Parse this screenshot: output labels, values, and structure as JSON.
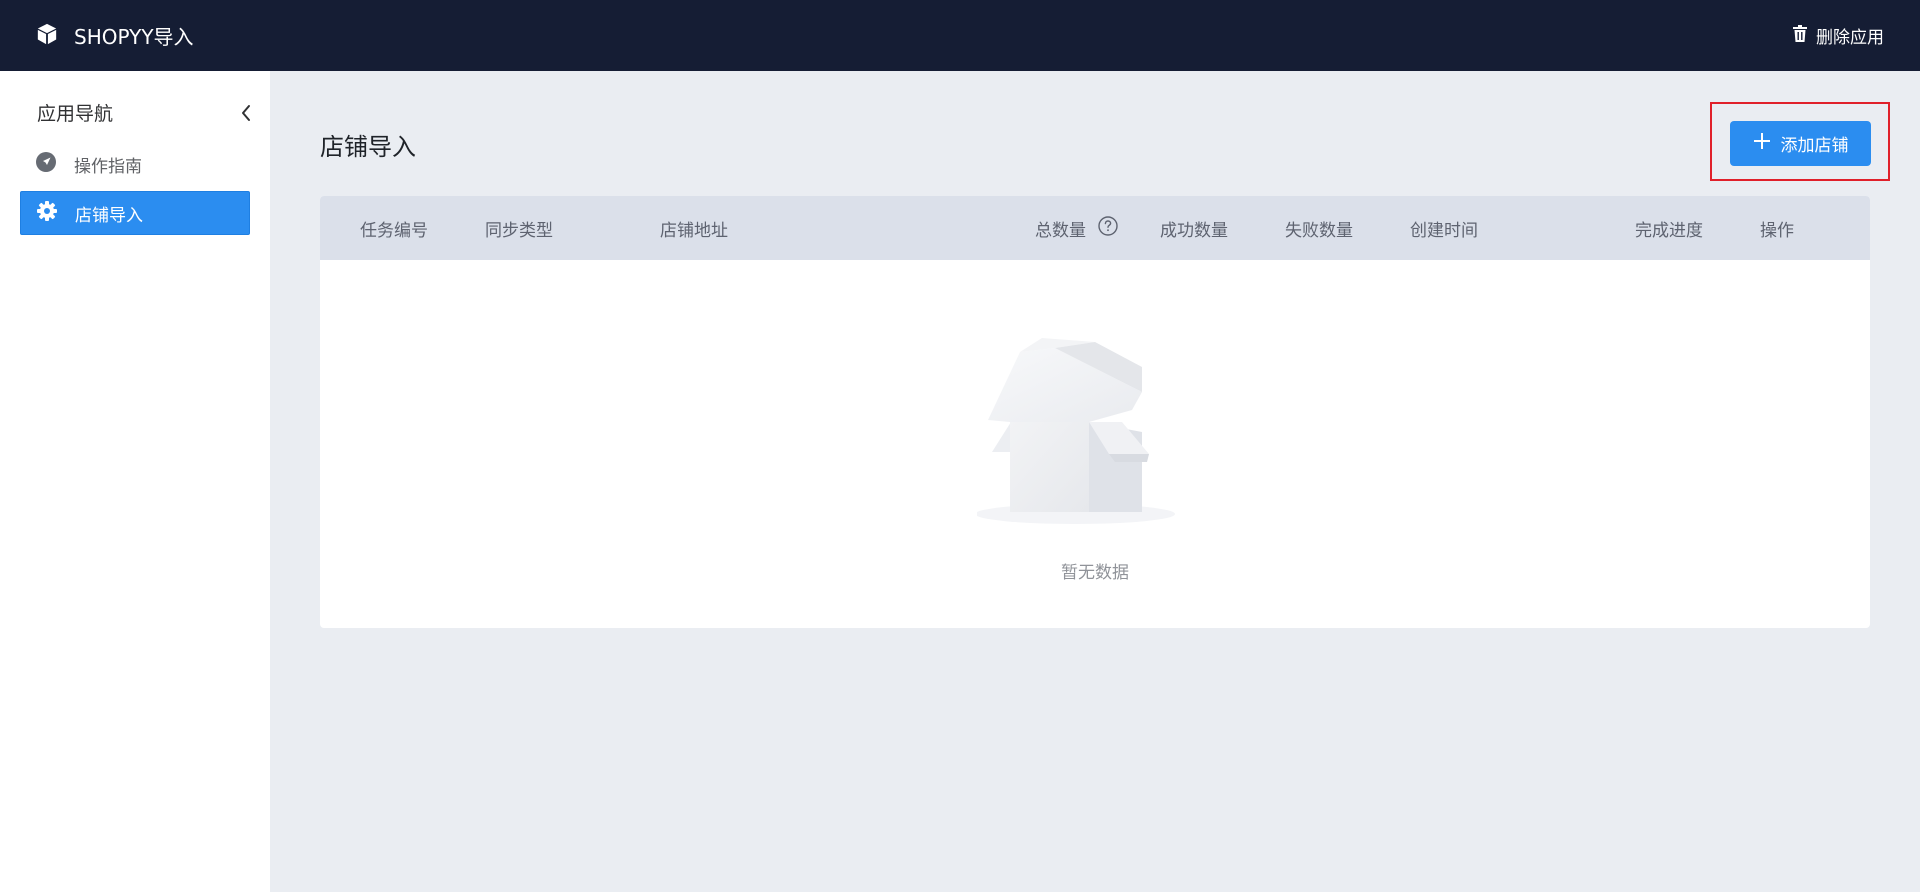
{
  "topbar": {
    "app_title": "SHOPYY导入",
    "app_icon": "cube-icon",
    "delete_label": "删除应用",
    "delete_icon": "trash-icon"
  },
  "sidebar": {
    "title": "应用导航",
    "items": [
      {
        "label": "操作指南",
        "icon": "compass-icon",
        "active": false
      },
      {
        "label": "店铺导入",
        "icon": "gear-icon",
        "active": true
      }
    ]
  },
  "main": {
    "title": "店铺导入",
    "add_button_label": "添加店铺",
    "table": {
      "columns": [
        "任务编号",
        "同步类型",
        "店铺地址",
        "总数量",
        "成功数量",
        "失败数量",
        "创建时间",
        "完成进度",
        "操作"
      ],
      "empty_text": "暂无数据"
    }
  },
  "colors": {
    "topbar": "#151d34",
    "accent": "#2b8df0",
    "highlight_border": "#e0202a",
    "background": "#eaedf2",
    "table_header": "#dbe0ea"
  }
}
